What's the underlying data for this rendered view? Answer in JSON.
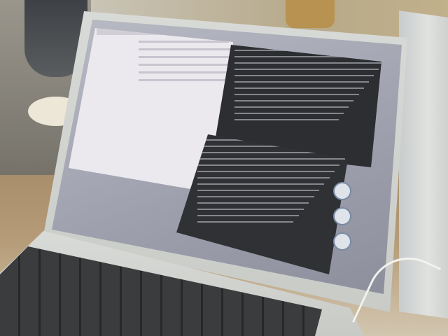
{
  "scene": {
    "description_tag": "",
    "colors": {
      "finder_bg": "#ebe8ee",
      "terminal_bg": "#2c2e31",
      "lid": "#d8dad7",
      "desk": "#b59b77"
    },
    "terminal_lines": 12,
    "terminal2_lines": 14,
    "finder_rows": 6,
    "dock_icons": [
      "finder-icon",
      "app-icon",
      "app-icon"
    ]
  }
}
